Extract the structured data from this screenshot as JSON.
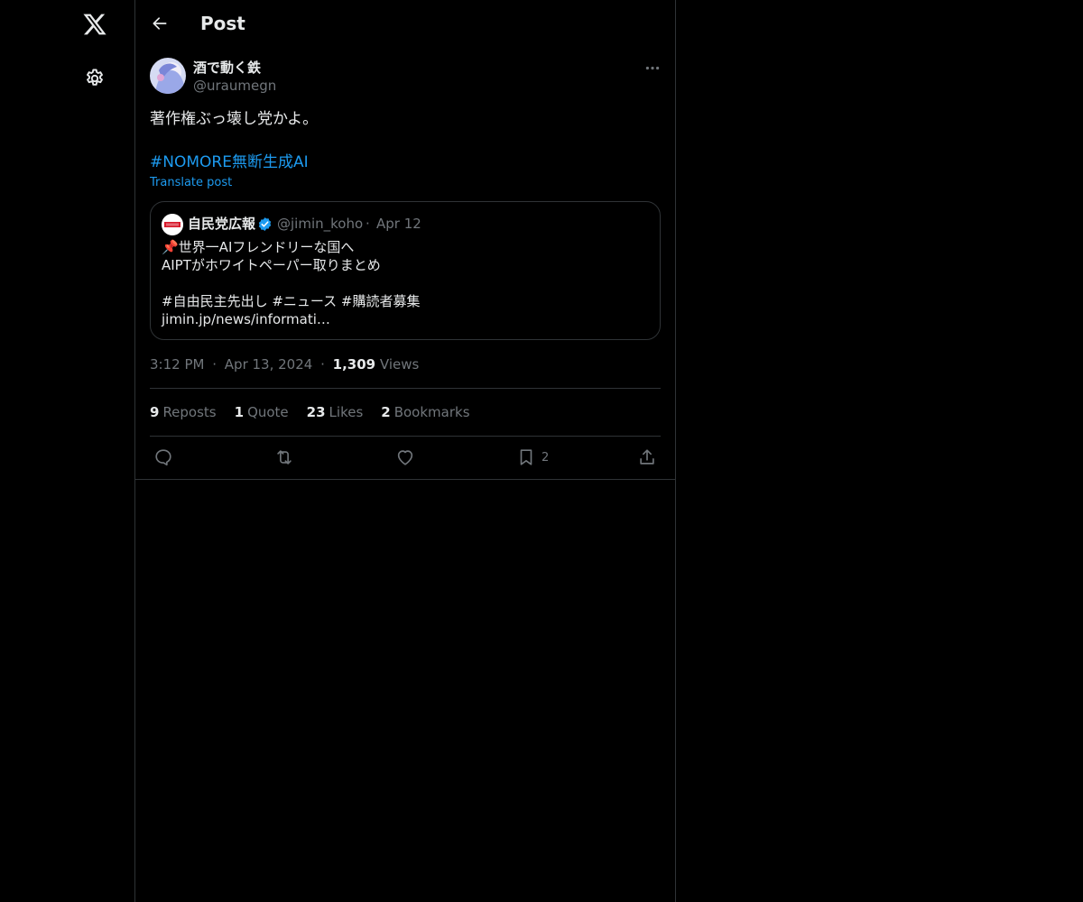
{
  "header": {
    "title": "Post"
  },
  "post": {
    "author_name": "酒で動く鉄",
    "author_handle": "@uraumegn",
    "text": "著作権ぶっ壊し党かよ。",
    "hashtag": "#NOMORE無断生成AI",
    "translate_label": "Translate post",
    "quote": {
      "author_name": "自民党広報",
      "author_handle": "@jimin_koho",
      "separator": "·",
      "date": "Apr 12",
      "lines": [
        "📌世界一AIフレンドリーな国へ",
        "AIPTがホワイトペーパー取りまとめ",
        "",
        "#自由民主先出し #ニュース #購読者募集",
        "jimin.jp/news/informati…"
      ]
    },
    "time": "3:12 PM",
    "separator": "·",
    "date": "Apr 13, 2024",
    "views_count": "1,309",
    "views_label": "Views",
    "stats": {
      "reposts_count": "9",
      "reposts_label": "Reposts",
      "quote_count": "1",
      "quote_label": "Quote",
      "likes_count": "23",
      "likes_label": "Likes",
      "bookmarks_count": "2",
      "bookmarks_label": "Bookmarks"
    },
    "actions": {
      "bookmark_count": "2"
    }
  },
  "icons": {
    "nav": [
      "x-logo-icon",
      "gear-icon"
    ],
    "header": "arrow-left-icon",
    "actions": [
      "reply-icon",
      "repost-icon",
      "heart-icon",
      "bookmark-icon",
      "share-icon"
    ]
  },
  "colors": {
    "background": "#000000",
    "text": "#e7e9ea",
    "muted": "#71767b",
    "link": "#1d9bf0",
    "border": "#2f3336",
    "verified": "#1d9bf0"
  }
}
